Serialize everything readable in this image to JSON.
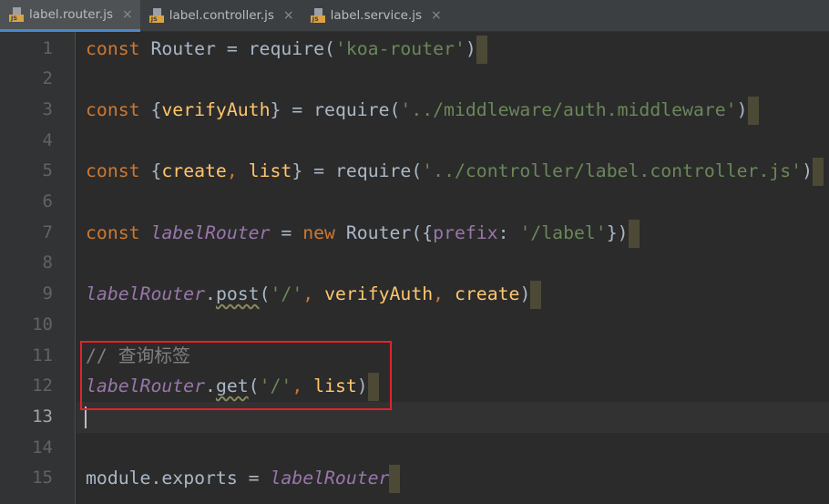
{
  "tabs": [
    {
      "label": "label.router.js",
      "active": true,
      "icon": "js-file-icon"
    },
    {
      "label": "label.controller.js",
      "active": false,
      "icon": "js-file-icon"
    },
    {
      "label": "label.service.js",
      "active": false,
      "icon": "js-file-icon"
    }
  ],
  "js_badge": "JS",
  "close_glyph": "×",
  "current_line": 13,
  "highlight_box_color": "#e0242c",
  "code": [
    [
      [
        "kw",
        "const "
      ],
      [
        "",
        "Router = require("
      ],
      [
        "str",
        "'koa-router'"
      ],
      [
        "",
        ")"
      ]
    ],
    [],
    [
      [
        "kw",
        "const "
      ],
      [
        "",
        "{"
      ],
      [
        "fn",
        "verifyAuth"
      ],
      [
        "",
        "} = require("
      ],
      [
        "str",
        "'../middleware/auth.middleware'"
      ],
      [
        "",
        ")"
      ]
    ],
    [],
    [
      [
        "kw",
        "const "
      ],
      [
        "",
        "{"
      ],
      [
        "fn",
        "create"
      ],
      [
        "kw",
        ", "
      ],
      [
        "fn",
        "list"
      ],
      [
        "",
        "} = require("
      ],
      [
        "str",
        "'../controller/label.controller.js'"
      ],
      [
        "",
        ")"
      ]
    ],
    [],
    [
      [
        "kw",
        "const "
      ],
      [
        "glob",
        "labelRouter"
      ],
      [
        "",
        " = "
      ],
      [
        "kw",
        "new "
      ],
      [
        "",
        "Router({"
      ],
      [
        "prop",
        "prefix"
      ],
      [
        "",
        ": "
      ],
      [
        "str",
        "'/label'"
      ],
      [
        "",
        "})"
      ]
    ],
    [],
    [
      [
        "glob",
        "labelRouter"
      ],
      [
        "",
        "."
      ],
      [
        "wavy",
        "post"
      ],
      [
        "",
        "("
      ],
      [
        "str",
        "'/'"
      ],
      [
        "kw",
        ", "
      ],
      [
        "fn",
        "verifyAuth"
      ],
      [
        "kw",
        ", "
      ],
      [
        "fn",
        "create"
      ],
      [
        "",
        ")"
      ]
    ],
    [],
    [
      [
        "cm",
        "// 查询标签"
      ]
    ],
    [
      [
        "glob",
        "labelRouter"
      ],
      [
        "",
        "."
      ],
      [
        "wavy",
        "get"
      ],
      [
        "",
        "("
      ],
      [
        "str",
        "'/'"
      ],
      [
        "kw",
        ", "
      ],
      [
        "fn",
        "list"
      ],
      [
        "",
        ")"
      ]
    ],
    [],
    [],
    [
      [
        "",
        "module."
      ],
      [
        "",
        "exports = "
      ],
      [
        "glob",
        "labelRouter"
      ]
    ]
  ]
}
